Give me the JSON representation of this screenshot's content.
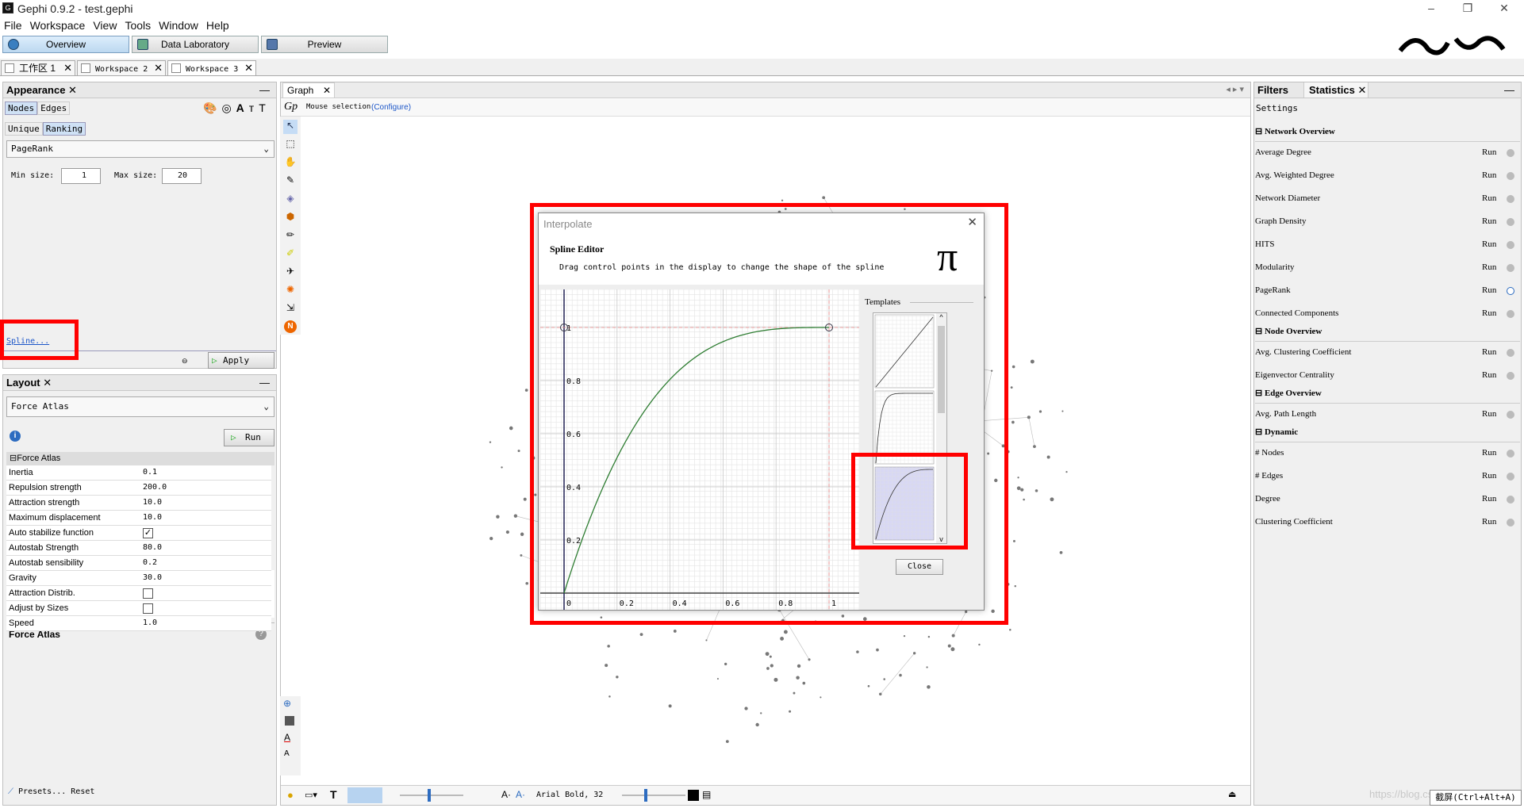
{
  "window": {
    "title": "Gephi 0.9.2 - test.gephi",
    "minimize": "–",
    "maximize": "❐",
    "close": "✕"
  },
  "menu": [
    "File",
    "Workspace",
    "View",
    "Tools",
    "Window",
    "Help"
  ],
  "modes": {
    "overview": "Overview",
    "data_lab": "Data Laboratory",
    "preview": "Preview"
  },
  "workspaces": [
    "工作区 1",
    "Workspace 2",
    "Workspace 3"
  ],
  "appearance": {
    "title": "Appearance",
    "tabs": [
      "Nodes",
      "Edges"
    ],
    "subtabs": [
      "Unique",
      "Ranking"
    ],
    "attribute": "PageRank",
    "min_label": "Min size:",
    "min_value": "1",
    "max_label": "Max size:",
    "max_value": "20",
    "spline": "Spline...",
    "apply": "Apply"
  },
  "layout": {
    "title": "Layout",
    "algorithm": "Force Atlas",
    "run": "Run",
    "section": "Force Atlas",
    "props": [
      {
        "k": "Inertia",
        "v": "0.1"
      },
      {
        "k": "Repulsion strength",
        "v": "200.0"
      },
      {
        "k": "Attraction strength",
        "v": "10.0"
      },
      {
        "k": "Maximum displacement",
        "v": "10.0"
      },
      {
        "k": "Auto stabilize function",
        "v": "",
        "checked": true
      },
      {
        "k": "Autostab Strength",
        "v": "80.0"
      },
      {
        "k": "Autostab sensibility",
        "v": "0.2"
      },
      {
        "k": "Gravity",
        "v": "30.0"
      },
      {
        "k": "Attraction Distrib.",
        "v": "",
        "checked": false
      },
      {
        "k": "Adjust by Sizes",
        "v": "",
        "checked": false
      },
      {
        "k": "Speed",
        "v": "1.0"
      }
    ],
    "desc_title": "Force Atlas",
    "presets": "Presets...",
    "reset": "Reset"
  },
  "graph": {
    "tab": "Graph",
    "mouse_selection": "Mouse selection",
    "configure": "(Configure)",
    "font": "Arial Bold, 32"
  },
  "dialog": {
    "title": "Interpolate",
    "heading": "Spline Editor",
    "subtitle": "Drag control points in the display to change the shape of the spline",
    "pi": "π",
    "templates": "Templates",
    "close": "Close",
    "y_ticks": [
      "1",
      "0.8",
      "0.6",
      "0.4",
      "0.2"
    ],
    "x_ticks": [
      "0",
      "0.2",
      "0.4",
      "0.6",
      "0.8",
      "1"
    ]
  },
  "right": {
    "tabs": [
      "Filters",
      "Statistics"
    ],
    "settings": "Settings",
    "sections": [
      {
        "title": "Network Overview",
        "items": [
          "Average Degree",
          "Avg. Weighted Degree",
          "Network Diameter",
          "Graph Density",
          "HITS",
          "Modularity",
          "PageRank",
          "Connected Components"
        ]
      },
      {
        "title": "Node Overview",
        "items": [
          "Avg. Clustering Coefficient",
          "Eigenvector Centrality"
        ]
      },
      {
        "title": "Edge Overview",
        "items": [
          "Avg. Path Length"
        ]
      },
      {
        "title": "Dynamic",
        "items": [
          "# Nodes",
          "# Edges",
          "Degree",
          "Clustering Coefficient"
        ]
      }
    ],
    "run": "Run"
  },
  "watermark": "https://blog.csdn.net",
  "screenshot_hint": "截屏(Ctrl+Alt+A)",
  "colors": {
    "accent": "#ff0000",
    "curve": "#2e7d32",
    "link": "#1c56c8"
  }
}
